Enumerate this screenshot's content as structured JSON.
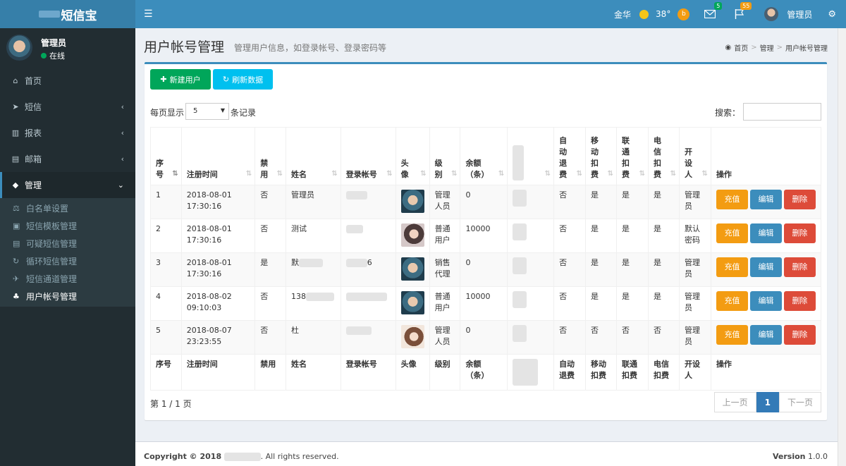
{
  "app": {
    "logo": "短信宝"
  },
  "topnav": {
    "city": "金华",
    "temp": "38°",
    "mail_count": "5",
    "flag_count": "55",
    "user": "管理员"
  },
  "sidebar": {
    "user_name": "管理员",
    "status": "在线",
    "items": [
      {
        "label": "首页",
        "icon": "home-icon",
        "glyph": "⌂"
      },
      {
        "label": "短信",
        "icon": "send-icon",
        "glyph": "➤"
      },
      {
        "label": "报表",
        "icon": "bar-chart-icon",
        "glyph": "▥"
      },
      {
        "label": "邮箱",
        "icon": "mail-icon",
        "glyph": "▤"
      },
      {
        "label": "管理",
        "icon": "diamond-icon",
        "glyph": "◆"
      }
    ],
    "submenu": [
      {
        "label": "白名单设置",
        "icon": "balance-icon",
        "glyph": "⚖"
      },
      {
        "label": "短信模板管理",
        "icon": "template-icon",
        "glyph": "▣"
      },
      {
        "label": "可疑短信管理",
        "icon": "list-icon",
        "glyph": "▤"
      },
      {
        "label": "循环短信管理",
        "icon": "refresh-icon",
        "glyph": "↻"
      },
      {
        "label": "短信通道管理",
        "icon": "rocket-icon",
        "glyph": "✈"
      },
      {
        "label": "用户帐号管理",
        "icon": "sitemap-icon",
        "glyph": "♣"
      }
    ]
  },
  "header": {
    "title": "用户帐号管理",
    "subtitle": "管理用户信息，如登录帐号、登录密码等"
  },
  "breadcrumb": {
    "home": "首页",
    "level1": "管理",
    "current": "用户帐号管理"
  },
  "toolbar": {
    "new_label": "新建用户",
    "refresh_label": "刷新数据"
  },
  "table_controls": {
    "show_prefix": "每页显示",
    "page_size": "5",
    "show_suffix": "条记录",
    "search_label": "搜索："
  },
  "table": {
    "headers": [
      "序号",
      "注册时间",
      "禁用",
      "姓名",
      "登录帐号",
      "头像",
      "级别",
      "余额（条）",
      "",
      "自动退费",
      "移动扣费",
      "联通扣费",
      "电信扣费",
      "开设人",
      "操作"
    ],
    "rows": [
      {
        "no": "1",
        "time": "2018-08-01 17:30:16",
        "disabled": "否",
        "name": "管理员",
        "account": "",
        "avatar": "boy",
        "level": "管理人员",
        "balance": "0",
        "auto": "否",
        "mobile": "是",
        "unicom": "是",
        "telecom": "是",
        "creator": "管理员"
      },
      {
        "no": "2",
        "time": "2018-08-01 17:30:16",
        "disabled": "否",
        "name": "测试",
        "account": "",
        "avatar": "girl1",
        "level": "普通用户",
        "balance": "10000",
        "auto": "否",
        "mobile": "是",
        "unicom": "是",
        "telecom": "是",
        "creator": "默认密码"
      },
      {
        "no": "3",
        "time": "2018-08-01 17:30:16",
        "disabled": "是",
        "name": "默",
        "account": "6",
        "avatar": "boy",
        "level": "销售代理",
        "balance": "0",
        "auto": "否",
        "mobile": "是",
        "unicom": "是",
        "telecom": "是",
        "creator": "管理员"
      },
      {
        "no": "4",
        "time": "2018-08-02 09:10:03",
        "disabled": "否",
        "name": "138",
        "account": "",
        "avatar": "boy",
        "level": "普通用户",
        "balance": "10000",
        "auto": "否",
        "mobile": "是",
        "unicom": "是",
        "telecom": "是",
        "creator": "管理员"
      },
      {
        "no": "5",
        "time": "2018-08-07 23:23:55",
        "disabled": "否",
        "name": "杜",
        "account": "",
        "avatar": "girl2",
        "level": "管理人员",
        "balance": "0",
        "auto": "否",
        "mobile": "否",
        "unicom": "否",
        "telecom": "否",
        "creator": "管理员"
      }
    ],
    "actions": {
      "charge": "充值",
      "edit": "编辑",
      "delete": "删除"
    }
  },
  "pagination": {
    "info": "第 1 / 1 页",
    "prev": "上一页",
    "page": "1",
    "next": "下一页"
  },
  "footer": {
    "copyright_prefix": "Copyright © 2018",
    "copyright_suffix": ". All rights reserved.",
    "version_label": "Version",
    "version": "1.0.0"
  },
  "colors": {
    "primary": "#3c8dbc",
    "sidebar": "#222d32",
    "success": "#00a65a",
    "info": "#00c0ef",
    "warning": "#f39c12",
    "danger": "#dd4b39"
  }
}
